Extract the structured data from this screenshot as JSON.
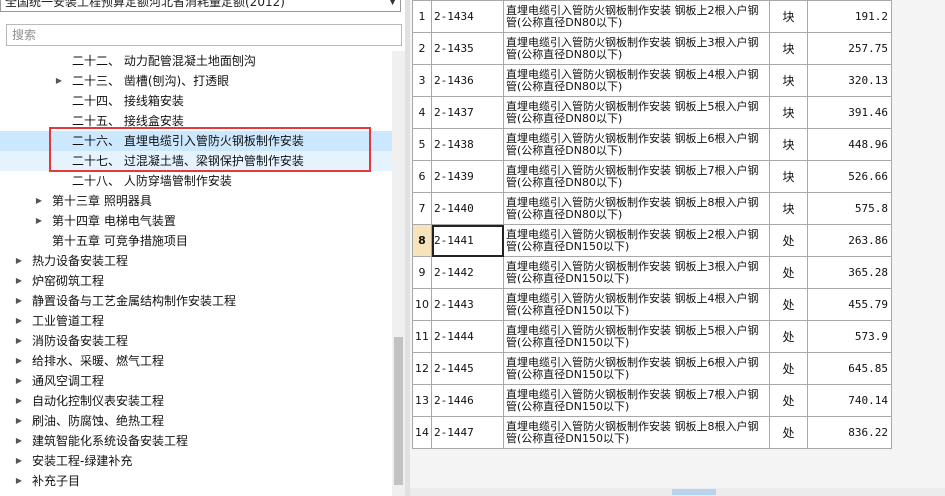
{
  "top_select": "全国统一安装工程预算定额河北省消耗量定额(2012)",
  "search": {
    "placeholder": "搜索"
  },
  "tree": [
    {
      "label": "二十二、 动力配管混凝土地面刨沟",
      "indent": 72,
      "toggle": ""
    },
    {
      "label": "二十三、 凿槽(刨沟)、打透眼",
      "indent": 72,
      "toggle": "right"
    },
    {
      "label": "二十四、 接线箱安装",
      "indent": 72,
      "toggle": ""
    },
    {
      "label": "二十五、 接线盒安装",
      "indent": 72,
      "toggle": ""
    },
    {
      "label": "二十六、 直埋电缆引入管防火钢板制作安装",
      "indent": 72,
      "toggle": "",
      "state": "selected"
    },
    {
      "label": "二十七、 过混凝土墙、梁钢保护管制作安装",
      "indent": 72,
      "toggle": "",
      "state": "hover"
    },
    {
      "label": "二十八、 人防穿墙管制作安装",
      "indent": 72,
      "toggle": ""
    },
    {
      "label": "第十三章 照明器具",
      "indent": 52,
      "toggle": "right"
    },
    {
      "label": "第十四章 电梯电气装置",
      "indent": 52,
      "toggle": "right"
    },
    {
      "label": "第十五章 可竞争措施项目",
      "indent": 52,
      "toggle": ""
    },
    {
      "label": "热力设备安装工程",
      "indent": 32,
      "toggle": "right"
    },
    {
      "label": "炉窑砌筑工程",
      "indent": 32,
      "toggle": "right"
    },
    {
      "label": "静置设备与工艺金属结构制作安装工程",
      "indent": 32,
      "toggle": "right"
    },
    {
      "label": "工业管道工程",
      "indent": 32,
      "toggle": "right"
    },
    {
      "label": "消防设备安装工程",
      "indent": 32,
      "toggle": "right"
    },
    {
      "label": "给排水、采暖、燃气工程",
      "indent": 32,
      "toggle": "right"
    },
    {
      "label": "通风空调工程",
      "indent": 32,
      "toggle": "right"
    },
    {
      "label": "自动化控制仪表安装工程",
      "indent": 32,
      "toggle": "right"
    },
    {
      "label": "刷油、防腐蚀、绝热工程",
      "indent": 32,
      "toggle": "right"
    },
    {
      "label": "建筑智能化系统设备安装工程",
      "indent": 32,
      "toggle": "right"
    },
    {
      "label": "安装工程-绿建补充",
      "indent": 32,
      "toggle": "right"
    },
    {
      "label": "补充子目",
      "indent": 32,
      "toggle": "right"
    }
  ],
  "grid": {
    "rows": [
      {
        "no": "1",
        "code": "2-1434",
        "name": "直埋电缆引入管防火钢板制作安装 钢板上2根入户钢管(公称直径DN80以下)",
        "unit": "块",
        "price": "191.2"
      },
      {
        "no": "2",
        "code": "2-1435",
        "name": "直埋电缆引入管防火钢板制作安装 钢板上3根入户钢管(公称直径DN80以下)",
        "unit": "块",
        "price": "257.75"
      },
      {
        "no": "3",
        "code": "2-1436",
        "name": "直埋电缆引入管防火钢板制作安装 钢板上4根入户钢管(公称直径DN80以下)",
        "unit": "块",
        "price": "320.13"
      },
      {
        "no": "4",
        "code": "2-1437",
        "name": "直埋电缆引入管防火钢板制作安装 钢板上5根入户钢管(公称直径DN80以下)",
        "unit": "块",
        "price": "391.46"
      },
      {
        "no": "5",
        "code": "2-1438",
        "name": "直埋电缆引入管防火钢板制作安装 钢板上6根入户钢管(公称直径DN80以下)",
        "unit": "块",
        "price": "448.96"
      },
      {
        "no": "6",
        "code": "2-1439",
        "name": "直埋电缆引入管防火钢板制作安装 钢板上7根入户钢管(公称直径DN80以下)",
        "unit": "块",
        "price": "526.66"
      },
      {
        "no": "7",
        "code": "2-1440",
        "name": "直埋电缆引入管防火钢板制作安装 钢板上8根入户钢管(公称直径DN80以下)",
        "unit": "块",
        "price": "575.8"
      },
      {
        "no": "8",
        "code": "2-1441",
        "name": "直埋电缆引入管防火钢板制作安装 钢板上2根入户钢管(公称直径DN150以下)",
        "unit": "处",
        "price": "263.86",
        "active": true
      },
      {
        "no": "9",
        "code": "2-1442",
        "name": "直埋电缆引入管防火钢板制作安装 钢板上3根入户钢管(公称直径DN150以下)",
        "unit": "处",
        "price": "365.28"
      },
      {
        "no": "10",
        "code": "2-1443",
        "name": "直埋电缆引入管防火钢板制作安装 钢板上4根入户钢管(公称直径DN150以下)",
        "unit": "处",
        "price": "455.79"
      },
      {
        "no": "11",
        "code": "2-1444",
        "name": "直埋电缆引入管防火钢板制作安装 钢板上5根入户钢管(公称直径DN150以下)",
        "unit": "处",
        "price": "573.9"
      },
      {
        "no": "12",
        "code": "2-1445",
        "name": "直埋电缆引入管防火钢板制作安装 钢板上6根入户钢管(公称直径DN150以下)",
        "unit": "处",
        "price": "645.85"
      },
      {
        "no": "13",
        "code": "2-1446",
        "name": "直埋电缆引入管防火钢板制作安装 钢板上7根入户钢管(公称直径DN150以下)",
        "unit": "处",
        "price": "740.14"
      },
      {
        "no": "14",
        "code": "2-1447",
        "name": "直埋电缆引入管防火钢板制作安装 钢板上8根入户钢管(公称直径DN150以下)",
        "unit": "处",
        "price": "836.22"
      }
    ]
  },
  "colors": {
    "selected_row": "#cce8ff",
    "hover_row": "#e5f3ff",
    "highlight_box": "#e23a3a",
    "active_row_number": "#f6e3b9"
  }
}
